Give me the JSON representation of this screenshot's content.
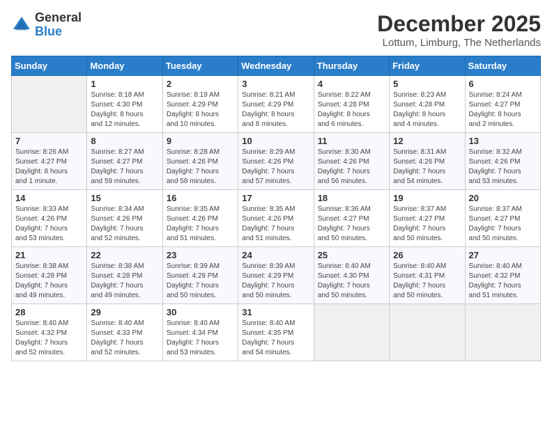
{
  "header": {
    "logo_general": "General",
    "logo_blue": "Blue",
    "month_title": "December 2025",
    "location": "Lottum, Limburg, The Netherlands"
  },
  "days_of_week": [
    "Sunday",
    "Monday",
    "Tuesday",
    "Wednesday",
    "Thursday",
    "Friday",
    "Saturday"
  ],
  "weeks": [
    [
      {
        "day": "",
        "info": ""
      },
      {
        "day": "1",
        "info": "Sunrise: 8:18 AM\nSunset: 4:30 PM\nDaylight: 8 hours\nand 12 minutes."
      },
      {
        "day": "2",
        "info": "Sunrise: 8:19 AM\nSunset: 4:29 PM\nDaylight: 8 hours\nand 10 minutes."
      },
      {
        "day": "3",
        "info": "Sunrise: 8:21 AM\nSunset: 4:29 PM\nDaylight: 8 hours\nand 8 minutes."
      },
      {
        "day": "4",
        "info": "Sunrise: 8:22 AM\nSunset: 4:28 PM\nDaylight: 8 hours\nand 6 minutes."
      },
      {
        "day": "5",
        "info": "Sunrise: 8:23 AM\nSunset: 4:28 PM\nDaylight: 8 hours\nand 4 minutes."
      },
      {
        "day": "6",
        "info": "Sunrise: 8:24 AM\nSunset: 4:27 PM\nDaylight: 8 hours\nand 2 minutes."
      }
    ],
    [
      {
        "day": "7",
        "info": "Sunrise: 8:26 AM\nSunset: 4:27 PM\nDaylight: 8 hours\nand 1 minute."
      },
      {
        "day": "8",
        "info": "Sunrise: 8:27 AM\nSunset: 4:27 PM\nDaylight: 7 hours\nand 59 minutes."
      },
      {
        "day": "9",
        "info": "Sunrise: 8:28 AM\nSunset: 4:26 PM\nDaylight: 7 hours\nand 58 minutes."
      },
      {
        "day": "10",
        "info": "Sunrise: 8:29 AM\nSunset: 4:26 PM\nDaylight: 7 hours\nand 57 minutes."
      },
      {
        "day": "11",
        "info": "Sunrise: 8:30 AM\nSunset: 4:26 PM\nDaylight: 7 hours\nand 56 minutes."
      },
      {
        "day": "12",
        "info": "Sunrise: 8:31 AM\nSunset: 4:26 PM\nDaylight: 7 hours\nand 54 minutes."
      },
      {
        "day": "13",
        "info": "Sunrise: 8:32 AM\nSunset: 4:26 PM\nDaylight: 7 hours\nand 53 minutes."
      }
    ],
    [
      {
        "day": "14",
        "info": "Sunrise: 8:33 AM\nSunset: 4:26 PM\nDaylight: 7 hours\nand 53 minutes."
      },
      {
        "day": "15",
        "info": "Sunrise: 8:34 AM\nSunset: 4:26 PM\nDaylight: 7 hours\nand 52 minutes."
      },
      {
        "day": "16",
        "info": "Sunrise: 8:35 AM\nSunset: 4:26 PM\nDaylight: 7 hours\nand 51 minutes."
      },
      {
        "day": "17",
        "info": "Sunrise: 8:35 AM\nSunset: 4:26 PM\nDaylight: 7 hours\nand 51 minutes."
      },
      {
        "day": "18",
        "info": "Sunrise: 8:36 AM\nSunset: 4:27 PM\nDaylight: 7 hours\nand 50 minutes."
      },
      {
        "day": "19",
        "info": "Sunrise: 8:37 AM\nSunset: 4:27 PM\nDaylight: 7 hours\nand 50 minutes."
      },
      {
        "day": "20",
        "info": "Sunrise: 8:37 AM\nSunset: 4:27 PM\nDaylight: 7 hours\nand 50 minutes."
      }
    ],
    [
      {
        "day": "21",
        "info": "Sunrise: 8:38 AM\nSunset: 4:28 PM\nDaylight: 7 hours\nand 49 minutes."
      },
      {
        "day": "22",
        "info": "Sunrise: 8:38 AM\nSunset: 4:28 PM\nDaylight: 7 hours\nand 49 minutes."
      },
      {
        "day": "23",
        "info": "Sunrise: 8:39 AM\nSunset: 4:29 PM\nDaylight: 7 hours\nand 50 minutes."
      },
      {
        "day": "24",
        "info": "Sunrise: 8:39 AM\nSunset: 4:29 PM\nDaylight: 7 hours\nand 50 minutes."
      },
      {
        "day": "25",
        "info": "Sunrise: 8:40 AM\nSunset: 4:30 PM\nDaylight: 7 hours\nand 50 minutes."
      },
      {
        "day": "26",
        "info": "Sunrise: 8:40 AM\nSunset: 4:31 PM\nDaylight: 7 hours\nand 50 minutes."
      },
      {
        "day": "27",
        "info": "Sunrise: 8:40 AM\nSunset: 4:32 PM\nDaylight: 7 hours\nand 51 minutes."
      }
    ],
    [
      {
        "day": "28",
        "info": "Sunrise: 8:40 AM\nSunset: 4:32 PM\nDaylight: 7 hours\nand 52 minutes."
      },
      {
        "day": "29",
        "info": "Sunrise: 8:40 AM\nSunset: 4:33 PM\nDaylight: 7 hours\nand 52 minutes."
      },
      {
        "day": "30",
        "info": "Sunrise: 8:40 AM\nSunset: 4:34 PM\nDaylight: 7 hours\nand 53 minutes."
      },
      {
        "day": "31",
        "info": "Sunrise: 8:40 AM\nSunset: 4:35 PM\nDaylight: 7 hours\nand 54 minutes."
      },
      {
        "day": "",
        "info": ""
      },
      {
        "day": "",
        "info": ""
      },
      {
        "day": "",
        "info": ""
      }
    ]
  ]
}
